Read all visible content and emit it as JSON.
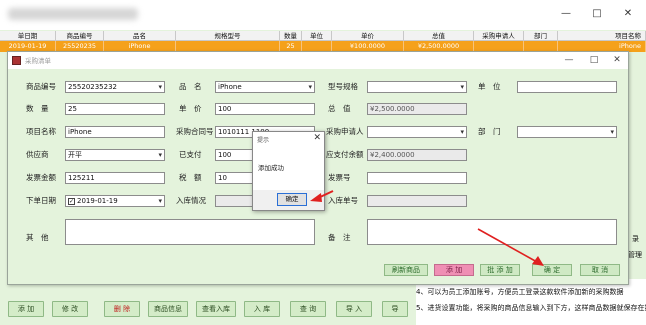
{
  "main_window": {
    "controls": [
      "—",
      "□",
      "✕"
    ],
    "grid": {
      "columns": [
        "单日期",
        "商品编号",
        "品名",
        "规格型号",
        "数量",
        "单位",
        "单价",
        "总值",
        "采购申请人",
        "部门",
        "项目名称"
      ],
      "selected_row": [
        "2019-01-19",
        "25520235",
        "iPhone",
        "",
        "25",
        "",
        "¥100.0000",
        "¥2,500.0000",
        "",
        "",
        "iPhone"
      ]
    },
    "bottom_buttons": [
      "添 加",
      "修 改",
      "删 除",
      "商品信息",
      "查看入库",
      "入 库",
      "查 询",
      "导 入",
      "导"
    ],
    "right_edge": [
      "录",
      "管理"
    ],
    "notes": [
      "4、可以为员工添加账号，方便员工登录这款软件添加新的采购数据",
      "5、进货设置功能，将采购的商品信息输入到下方，这样商品数据就保存在数"
    ]
  },
  "dialog": {
    "title": "采购清单",
    "controls": [
      "—",
      "□",
      "✕"
    ],
    "fields": {
      "item_code_label": "商品编号",
      "item_code": "25520235232",
      "name_label": "品　名",
      "name": "iPhone",
      "spec_label": "型号规格",
      "spec": "",
      "unit_label": "单　位",
      "unit": "",
      "qty_label": "数　量",
      "qty": "25",
      "price_label": "单　价",
      "price": "100",
      "total_label": "总　值",
      "total": "¥2,500.0000",
      "project_label": "项目名称",
      "project": "iPhone",
      "contract_label": "采购合同号",
      "contract": "1010111 1100",
      "applicant_label": "采购申请人",
      "applicant": "",
      "dept_label": "部　门",
      "dept": "",
      "supplier_label": "供应商",
      "supplier": "开平",
      "paid_label": "已支付",
      "paid": "100",
      "pending_label": "应支付余额",
      "pending": "¥2,400.0000",
      "invoice_amount_label": "发票金额",
      "invoice_amount": "125211",
      "tax_label": "税　额",
      "tax": "10",
      "invoice_no_label": "发票号",
      "invoice_no": "",
      "order_date_label": "下单日期",
      "order_date": "2019-01-19",
      "stock_status_label": "入库情况",
      "stock_status": "",
      "stock_no_label": "入库单号",
      "stock_no": "",
      "other_label": "其　他",
      "remark_label": "备　注"
    },
    "buttons": {
      "refresh": "刷新商品",
      "add": "添 加",
      "batch_add": "批 添 加",
      "confirm": "确 定",
      "cancel": "取 消"
    }
  },
  "message_box": {
    "title": "提示",
    "text": "添加成功",
    "ok": "确定"
  },
  "colors": {
    "background": "#e4f3dc",
    "selected_row": "#f5a11b",
    "annotation_arrow": "#e02020",
    "pink_button": "#ef8fb4"
  }
}
